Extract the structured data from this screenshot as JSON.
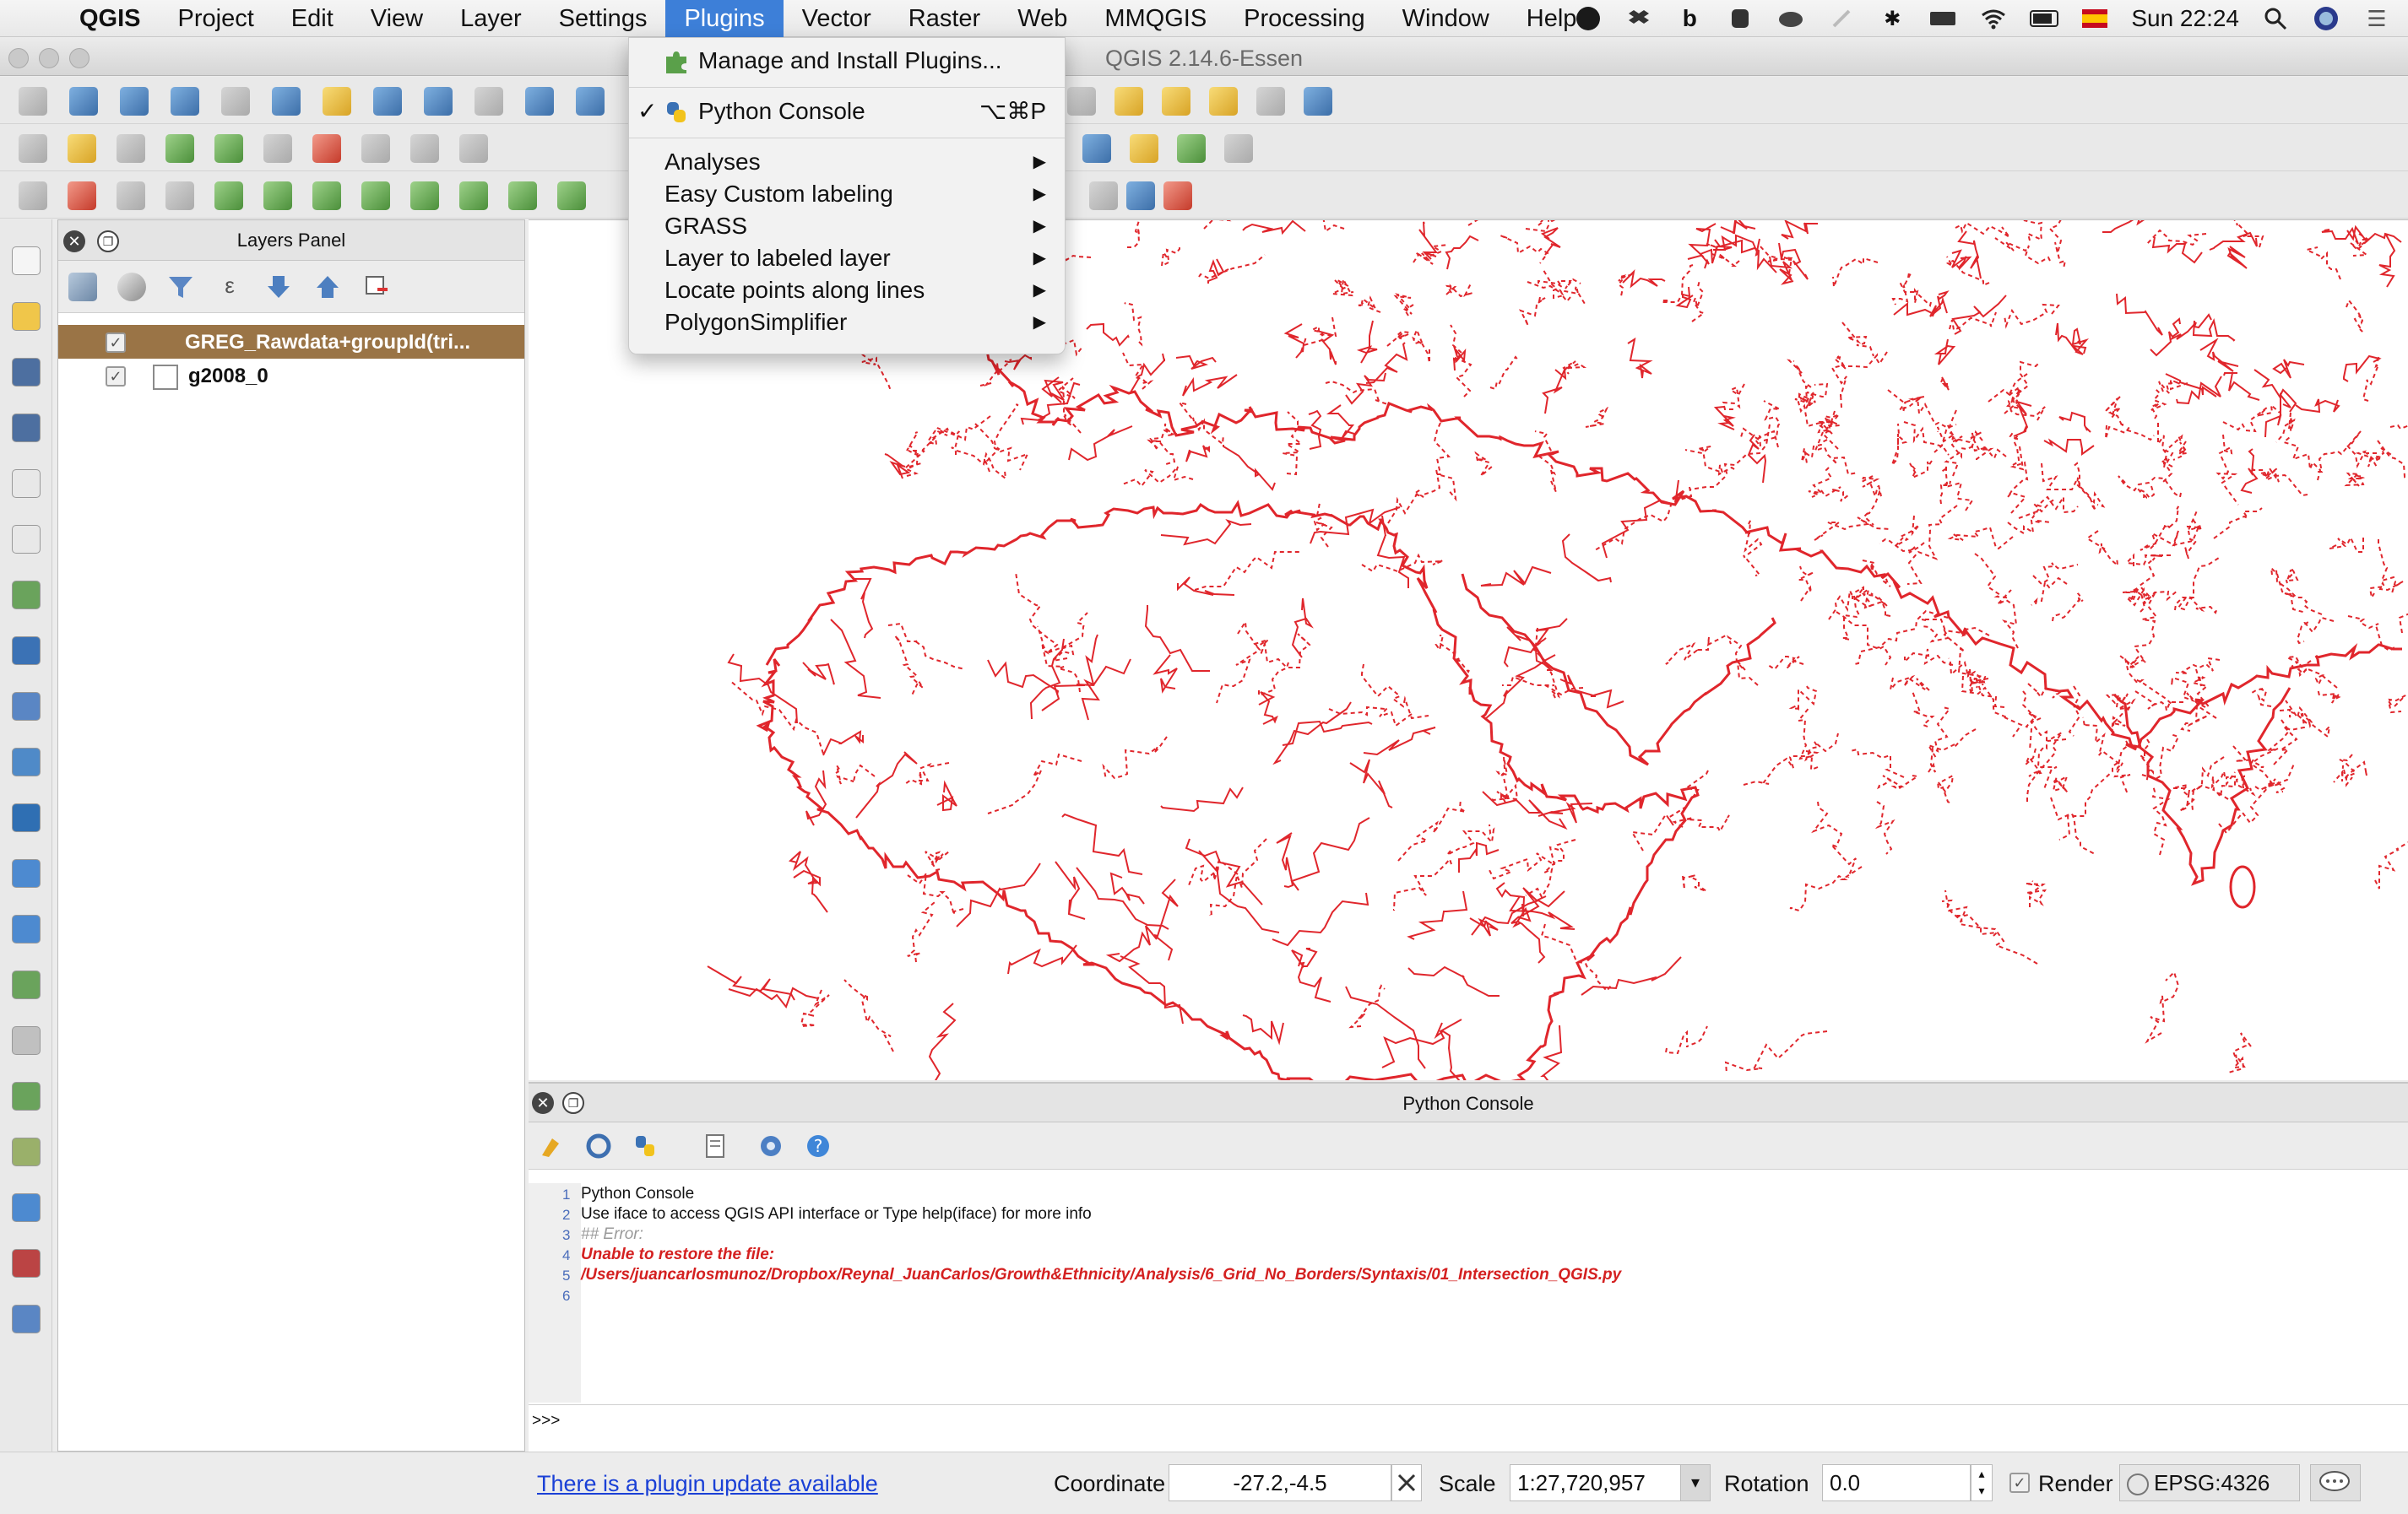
{
  "menubar": {
    "app": "QGIS",
    "items": [
      "Project",
      "Edit",
      "View",
      "Layer",
      "Settings",
      "Plugins",
      "Vector",
      "Raster",
      "Web",
      "MMQGIS",
      "Processing",
      "Window",
      "Help"
    ],
    "clock": "Sun 22:24"
  },
  "window": {
    "title": "QGIS 2.14.6-Essen"
  },
  "plugins_menu": {
    "manage": "Manage and Install Plugins...",
    "console": "Python Console",
    "console_check": "✓",
    "console_shortcut": "⌥⌘P",
    "submenus": [
      "Analyses",
      "Easy Custom labeling",
      "GRASS",
      "Layer to labeled layer",
      "Locate points along lines",
      "PolygonSimplifier"
    ]
  },
  "layers_panel": {
    "title": "Layers Panel",
    "layers": [
      {
        "name": "GREG_Rawdata+groupId(tri...",
        "checked": "✓"
      },
      {
        "name": "g2008_0",
        "checked": "✓"
      }
    ]
  },
  "console": {
    "title": "Python Console",
    "lines": [
      {
        "n": "1",
        "text": "Python Console"
      },
      {
        "n": "2",
        "text": "Use iface to access QGIS API interface or Type help(iface) for more info"
      },
      {
        "n": "3",
        "text": "## Error:"
      },
      {
        "n": "4",
        "text": "Unable to restore the file:"
      },
      {
        "n": "5",
        "text": "/Users/juancarlosmunoz/Dropbox/Reynal_JuanCarlos/Growth&Ethnicity/Analysis/6_Grid_No_Borders/Syntaxis/01_Intersection_QGIS.py"
      },
      {
        "n": "6",
        "text": ""
      }
    ],
    "prompt": ">>>"
  },
  "statusbar": {
    "plugin_update": "There is a plugin update available",
    "coordinate_label": "Coordinate",
    "coordinate_value": "-27.2,-4.5",
    "scale_label": "Scale",
    "scale_value": "1:27,720,957",
    "rotation_label": "Rotation",
    "rotation_value": "0.0",
    "render_label": "Render",
    "render_check": "✓",
    "crs": "EPSG:4326"
  },
  "colors": {
    "map_lines": "#e0262c",
    "accent": "#3d7fd8",
    "selected_layer": "#9a7446"
  }
}
